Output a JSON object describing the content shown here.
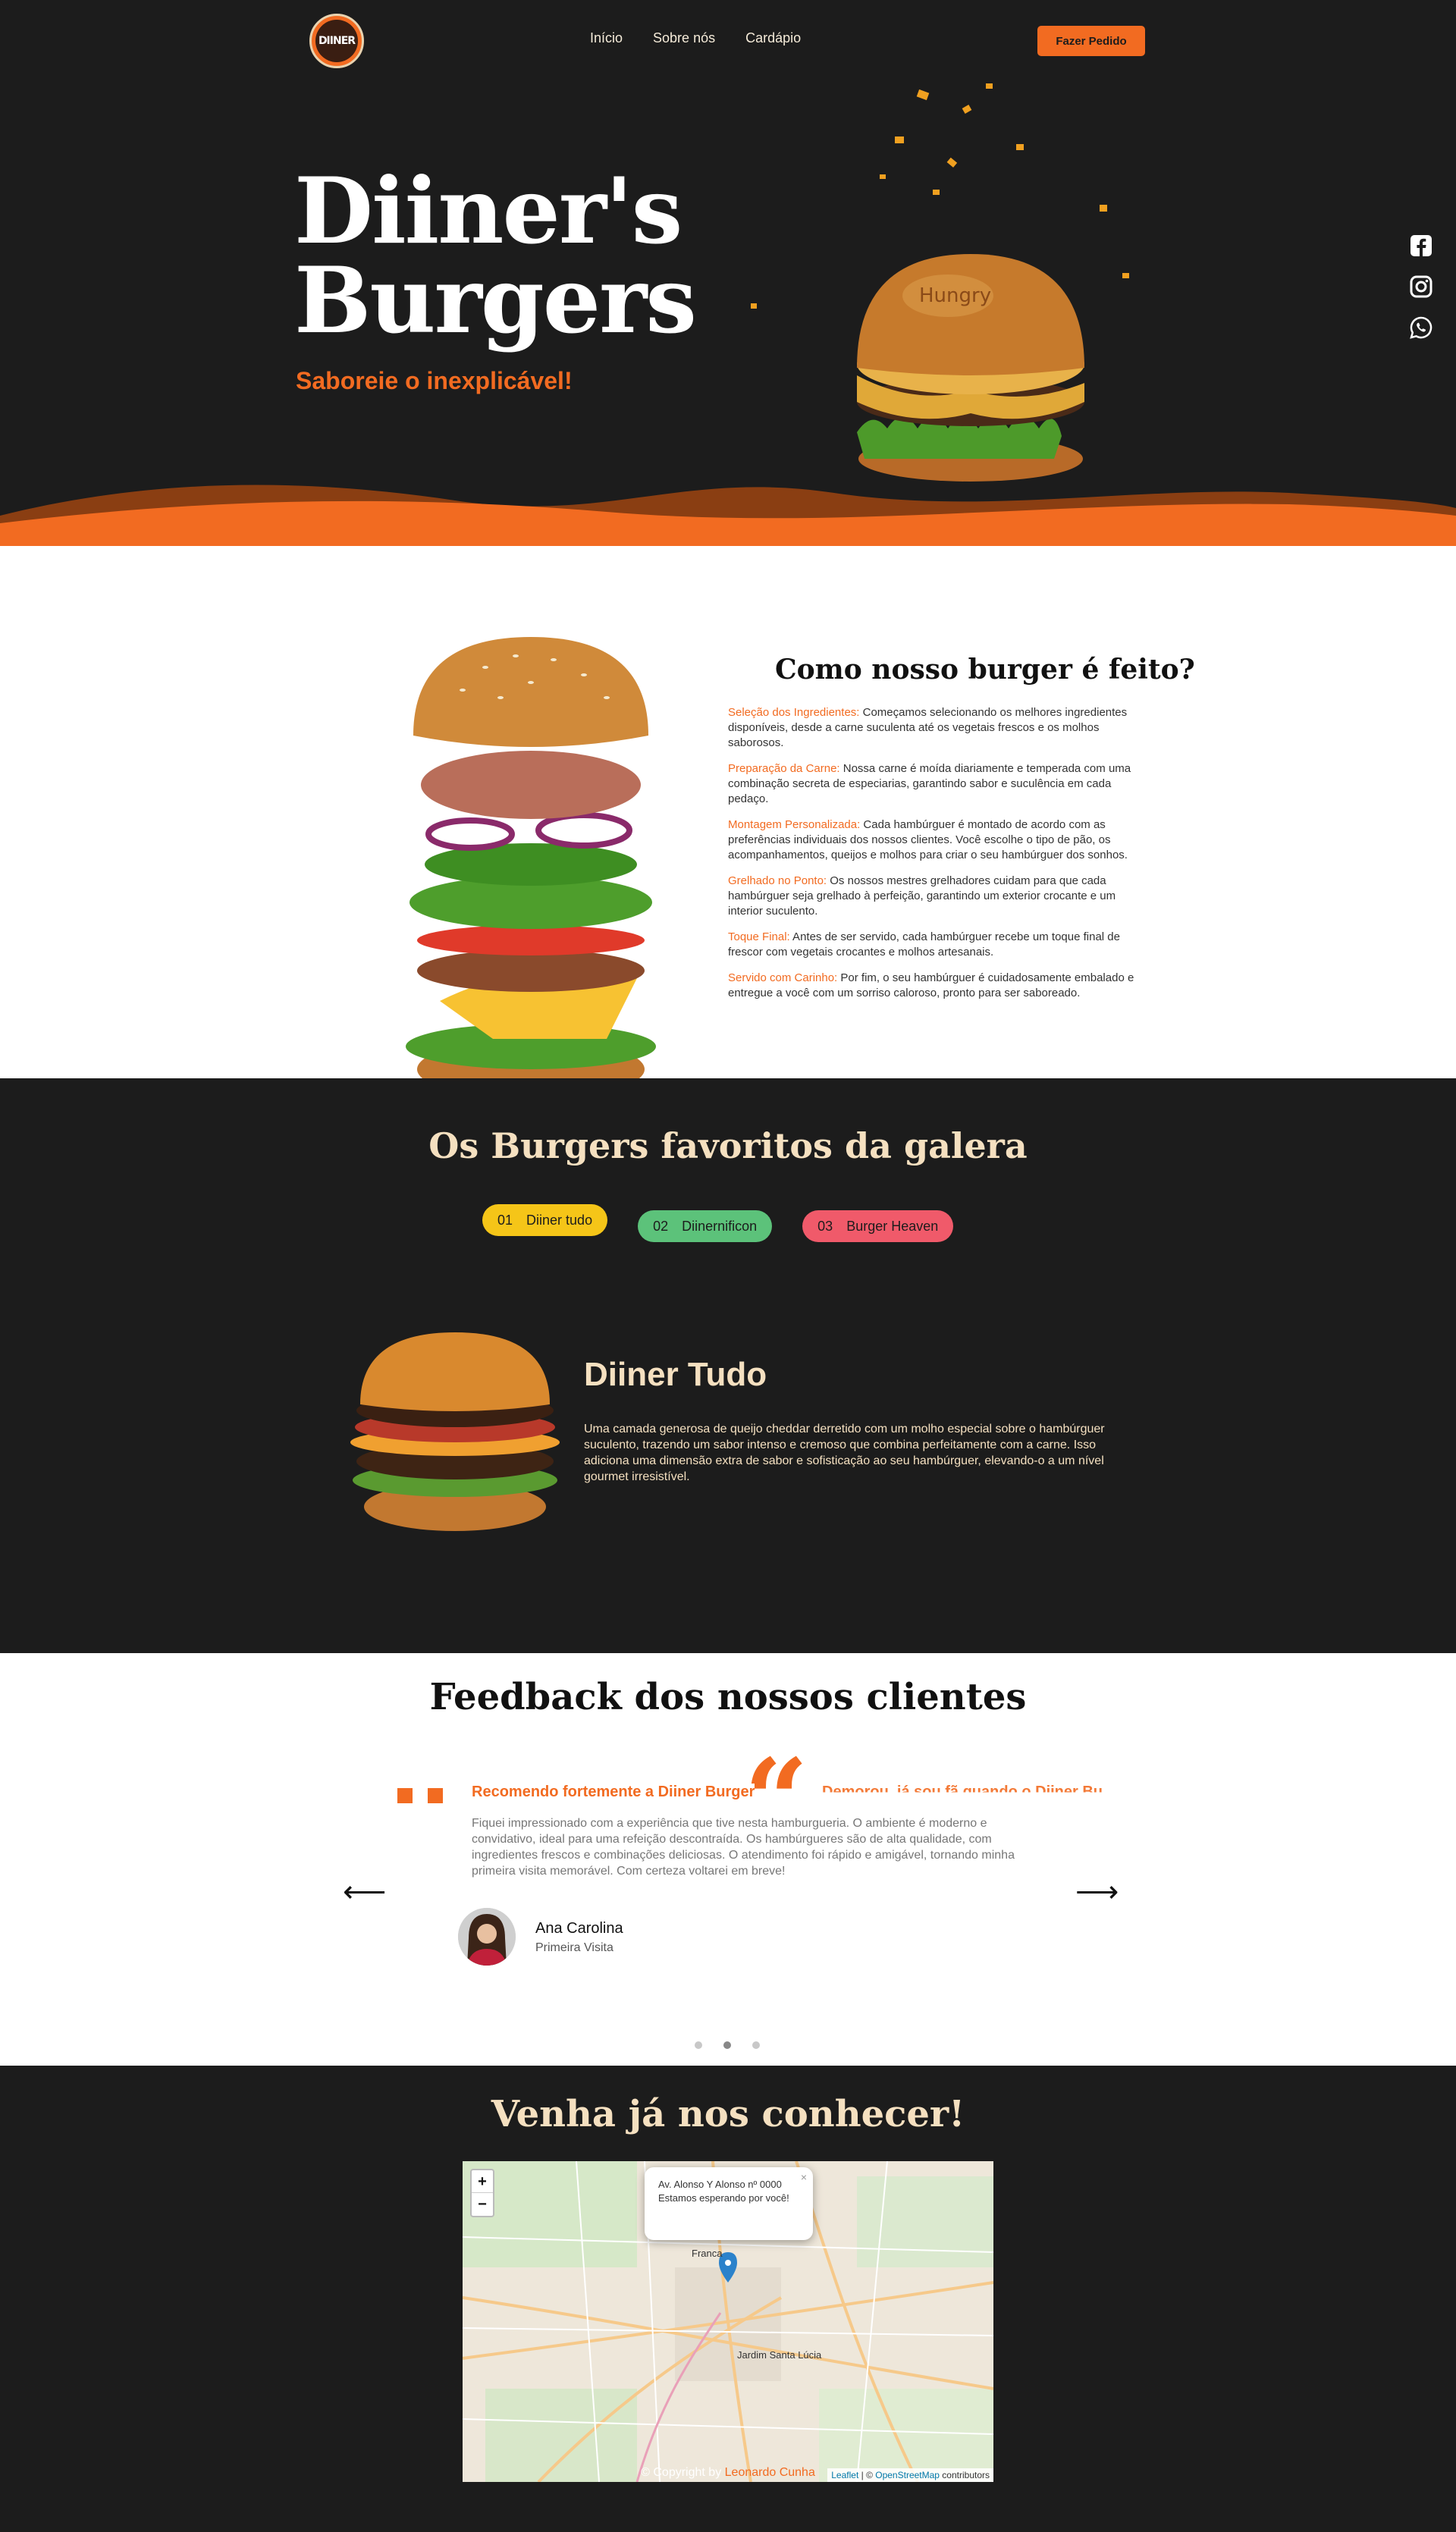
{
  "header": {
    "logo_text": "DIINER",
    "nav": [
      "Início",
      "Sobre nós",
      "Cardápio"
    ],
    "order_button": "Fazer Pedido"
  },
  "hero": {
    "title_line1": "Diiner's",
    "title_line2": "Burgers",
    "subtitle": "Saboreie o inexplicável!",
    "burger_brand": "Hungry"
  },
  "socials": [
    "facebook-icon",
    "instagram-icon",
    "whatsapp-icon"
  ],
  "how": {
    "title": "Como nosso burger é feito?",
    "steps": [
      {
        "label": "Seleção dos Ingredientes:",
        "text": " Começamos selecionando os melhores ingredientes disponíveis, desde a carne suculenta até os vegetais frescos e os molhos saborosos."
      },
      {
        "label": "Preparação da Carne:",
        "text": " Nossa carne é moída diariamente e temperada com uma combinação secreta de especiarias, garantindo sabor e suculência em cada pedaço."
      },
      {
        "label": "Montagem Personalizada:",
        "text": " Cada hambúrguer é montado de acordo com as preferências individuais dos nossos clientes. Você escolhe o tipo de pão, os acompanhamentos, queijos e molhos para criar o seu hambúrguer dos sonhos."
      },
      {
        "label": "Grelhado no Ponto:",
        "text": " Os nossos mestres grelhadores cuidam para que cada hambúrguer seja grelhado à perfeição, garantindo um exterior crocante e um interior suculento."
      },
      {
        "label": "Toque Final:",
        "text": " Antes de ser servido, cada hambúrguer recebe um toque final de frescor com vegetais crocantes e molhos artesanais."
      },
      {
        "label": "Servido com Carinho:",
        "text": " Por fim, o seu hambúrguer é cuidadosamente embalado e entregue a você com um sorriso caloroso, pronto para ser saboreado."
      }
    ]
  },
  "favorites": {
    "title": "Os Burgers favoritos da galera",
    "tabs": [
      {
        "num": "01",
        "label": "Diiner tudo",
        "color": "#f5c518"
      },
      {
        "num": "02",
        "label": "Diinernificon",
        "color": "#5cc27a"
      },
      {
        "num": "03",
        "label": "Burger Heaven",
        "color": "#f05a6a"
      }
    ],
    "active": {
      "name": "Diiner Tudo",
      "description": "Uma camada generosa de queijo cheddar derretido com um molho especial sobre o hambúrguer suculento, trazendo um sabor intenso e cremoso que combina perfeitamente com a carne. Isso adiciona uma dimensão extra de sabor e sofisticação ao seu hambúrguer, elevando-o a um nível gourmet irresistível."
    }
  },
  "feedback": {
    "title": "Feedback dos nossos clientes",
    "headline": "Recomendo fortemente a Diiner Burger",
    "next_headline": "Demorou, já sou fã quando o Diiner Bu",
    "text": "Fiquei impressionado com a experiência que tive nesta hamburgueria. O ambiente é moderno e convidativo, ideal para uma refeição descontraída. Os hambúrgueres são de alta qualidade, com ingredientes frescos e combinações deliciosas. O atendimento foi rápido e amigável, tornando minha primeira visita memorável. Com certeza voltarei em breve!",
    "name": "Ana Carolina",
    "role": "Primeira Visita",
    "arrow_prev": "⟵",
    "arrow_next": "⟶",
    "dots": 3,
    "active_dot": 2
  },
  "visit": {
    "title": "Venha já nos conhecer!",
    "zoom_in": "+",
    "zoom_out": "−",
    "popup_line1": "Av. Alonso Y Alonso nº 0000",
    "popup_line2": "Estamos esperando por você!",
    "popup_close": "×",
    "map_label_1": "Franca",
    "map_label_2": "Jardim Santa Lúcia",
    "attribution_leaflet": "Leaflet",
    "attribution_sep": " | © ",
    "attribution_osm": "OpenStreetMap",
    "attribution_tail": " contributors"
  },
  "footer": {
    "copyright_prefix": "© Copyright by ",
    "author": "Leonardo Cunha"
  },
  "colors": {
    "accent": "#f26b21",
    "dark": "#1c1c1c",
    "cream": "#f5e0c0"
  }
}
